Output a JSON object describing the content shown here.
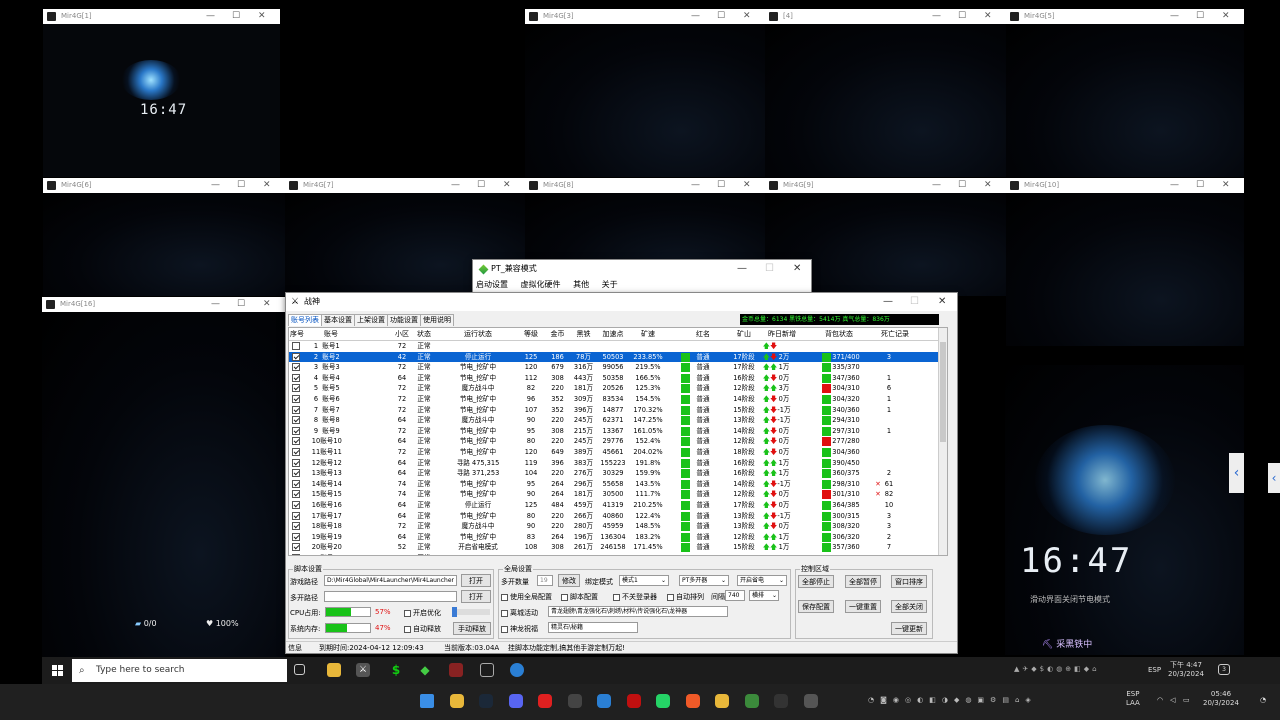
{
  "game_windows": [
    {
      "id": "w1",
      "title": "Mir4G[1]",
      "clock": "16:47"
    },
    {
      "id": "w3",
      "title": "Mir4G[3]"
    },
    {
      "id": "w4",
      "title": "[4]"
    },
    {
      "id": "w5",
      "title": "Mir4G[5]"
    },
    {
      "id": "w6",
      "title": "Mir4G[6]"
    },
    {
      "id": "w7",
      "title": "Mir4G[7]"
    },
    {
      "id": "w8",
      "title": "Mir4G[8]"
    },
    {
      "id": "w9",
      "title": "Mir4G[9]"
    },
    {
      "id": "w10",
      "title": "Mir4G[10]"
    },
    {
      "id": "w16",
      "title": "Mir4G[16]"
    }
  ],
  "game_hud": {
    "stat1": "0/0",
    "stat2": "100%"
  },
  "big_game": {
    "clock": "16:47",
    "hint": "滑动界面关闭节电模式",
    "status": "采黑铁中"
  },
  "pt_window": {
    "title": "PT_兼容模式",
    "menu": [
      "启动设置",
      "虚拟化硬件",
      "其他",
      "关于"
    ]
  },
  "main_window": {
    "title": "战神",
    "tabs": [
      "账号列表",
      "基本设置",
      "上架设置",
      "功能设置",
      "使用说明"
    ],
    "totals": "金币总量：6134  黑铁总量：5414万  真气总量：836万",
    "columns": [
      "序号",
      "账号",
      "小区",
      "状态",
      "运行状态",
      "等级",
      "金币",
      "黑铁",
      "加速点",
      "矿速",
      "红名",
      "矿山",
      "昨日新增",
      "背包状态",
      "死亡记录"
    ],
    "rows": [
      {
        "n": "1",
        "acct": "账号1",
        "zone": "72",
        "st": "正常",
        "run": "",
        "lv": "",
        "gold": "",
        "iron": "",
        "acc": "",
        "spd": "",
        "red": "",
        "mine": "",
        "y_dir": "up-down",
        "y": "",
        "bag": "",
        "bag_c": "",
        "death": "",
        "x": "",
        "chk": false
      },
      {
        "n": "2",
        "acct": "账号2",
        "zone": "42",
        "st": "正常",
        "run": "停止运行",
        "lv": "125",
        "gold": "186",
        "iron": "78万",
        "acc": "50503",
        "spd": "233.85%",
        "red": "普通",
        "mine": "17阶段",
        "y_dir": "up-down",
        "y": "2万",
        "bag": "371/400",
        "bag_c": "g",
        "death": "3",
        "x": "",
        "chk": true
      },
      {
        "n": "3",
        "acct": "账号3",
        "zone": "72",
        "st": "正常",
        "run": "节电_挖矿中",
        "lv": "120",
        "gold": "679",
        "iron": "316万",
        "acc": "99056",
        "spd": "219.5%",
        "red": "普通",
        "mine": "17阶段",
        "y_dir": "up-up",
        "y": "1万",
        "bag": "335/370",
        "bag_c": "g",
        "death": "",
        "x": "",
        "chk": true
      },
      {
        "n": "4",
        "acct": "账号4",
        "zone": "64",
        "st": "正常",
        "run": "节电_挖矿中",
        "lv": "112",
        "gold": "308",
        "iron": "443万",
        "acc": "50358",
        "spd": "166.5%",
        "red": "普通",
        "mine": "16阶段",
        "y_dir": "up-down",
        "y": "0万",
        "bag": "347/360",
        "bag_c": "g",
        "death": "1",
        "x": "",
        "chk": true
      },
      {
        "n": "5",
        "acct": "账号5",
        "zone": "72",
        "st": "正常",
        "run": "魔方战斗中",
        "lv": "82",
        "gold": "220",
        "iron": "181万",
        "acc": "20526",
        "spd": "125.3%",
        "red": "普通",
        "mine": "12阶段",
        "y_dir": "up-up",
        "y": "3万",
        "bag": "304/310",
        "bag_c": "r",
        "death": "6",
        "x": "",
        "chk": true
      },
      {
        "n": "6",
        "acct": "账号6",
        "zone": "72",
        "st": "正常",
        "run": "节电_挖矿中",
        "lv": "96",
        "gold": "352",
        "iron": "309万",
        "acc": "83534",
        "spd": "154.5%",
        "red": "普通",
        "mine": "14阶段",
        "y_dir": "up-down",
        "y": "0万",
        "bag": "304/320",
        "bag_c": "g",
        "death": "1",
        "x": "",
        "chk": true
      },
      {
        "n": "7",
        "acct": "账号7",
        "zone": "72",
        "st": "正常",
        "run": "节电_挖矿中",
        "lv": "107",
        "gold": "352",
        "iron": "396万",
        "acc": "14877",
        "spd": "170.32%",
        "red": "普通",
        "mine": "15阶段",
        "y_dir": "up-down",
        "y": "-1万",
        "bag": "340/360",
        "bag_c": "g",
        "death": "1",
        "x": "",
        "chk": true
      },
      {
        "n": "8",
        "acct": "账号8",
        "zone": "64",
        "st": "正常",
        "run": "魔方战斗中",
        "lv": "90",
        "gold": "220",
        "iron": "245万",
        "acc": "62371",
        "spd": "147.25%",
        "red": "普通",
        "mine": "13阶段",
        "y_dir": "up-down",
        "y": "-1万",
        "bag": "294/310",
        "bag_c": "g",
        "death": "",
        "x": "",
        "chk": true
      },
      {
        "n": "9",
        "acct": "账号9",
        "zone": "72",
        "st": "正常",
        "run": "节电_挖矿中",
        "lv": "95",
        "gold": "308",
        "iron": "215万",
        "acc": "13367",
        "spd": "161.05%",
        "red": "普通",
        "mine": "14阶段",
        "y_dir": "up-down",
        "y": "0万",
        "bag": "297/310",
        "bag_c": "g",
        "death": "1",
        "x": "",
        "chk": true
      },
      {
        "n": "10",
        "acct": "账号10",
        "zone": "64",
        "st": "正常",
        "run": "节电_挖矿中",
        "lv": "80",
        "gold": "220",
        "iron": "245万",
        "acc": "29776",
        "spd": "152.4%",
        "red": "普通",
        "mine": "12阶段",
        "y_dir": "up-down",
        "y": "0万",
        "bag": "277/280",
        "bag_c": "r",
        "death": "",
        "x": "",
        "chk": true
      },
      {
        "n": "11",
        "acct": "账号11",
        "zone": "72",
        "st": "正常",
        "run": "节电_挖矿中",
        "lv": "120",
        "gold": "649",
        "iron": "389万",
        "acc": "45661",
        "spd": "204.02%",
        "red": "普通",
        "mine": "18阶段",
        "y_dir": "up-down",
        "y": "0万",
        "bag": "304/360",
        "bag_c": "g",
        "death": "",
        "x": "",
        "chk": true
      },
      {
        "n": "12",
        "acct": "账号12",
        "zone": "64",
        "st": "正常",
        "run": "寻路 475,315",
        "lv": "119",
        "gold": "396",
        "iron": "383万",
        "acc": "155223",
        "spd": "191.8%",
        "red": "普通",
        "mine": "16阶段",
        "y_dir": "up-up",
        "y": "1万",
        "bag": "390/450",
        "bag_c": "g",
        "death": "",
        "x": "",
        "chk": true
      },
      {
        "n": "13",
        "acct": "账号13",
        "zone": "64",
        "st": "正常",
        "run": "寻路 371,253",
        "lv": "104",
        "gold": "220",
        "iron": "276万",
        "acc": "30329",
        "spd": "159.9%",
        "red": "普通",
        "mine": "16阶段",
        "y_dir": "up-up",
        "y": "1万",
        "bag": "360/375",
        "bag_c": "g",
        "death": "2",
        "x": "",
        "chk": true
      },
      {
        "n": "14",
        "acct": "账号14",
        "zone": "74",
        "st": "正常",
        "run": "节电_挖矿中",
        "lv": "95",
        "gold": "264",
        "iron": "296万",
        "acc": "55658",
        "spd": "143.5%",
        "red": "普通",
        "mine": "14阶段",
        "y_dir": "up-down",
        "y": "-1万",
        "bag": "298/310",
        "bag_c": "g",
        "death": "61",
        "x": "✕",
        "chk": true
      },
      {
        "n": "15",
        "acct": "账号15",
        "zone": "74",
        "st": "正常",
        "run": "节电_挖矿中",
        "lv": "90",
        "gold": "264",
        "iron": "181万",
        "acc": "30500",
        "spd": "111.7%",
        "red": "普通",
        "mine": "12阶段",
        "y_dir": "up-down",
        "y": "0万",
        "bag": "301/310",
        "bag_c": "r",
        "death": "82",
        "x": "✕",
        "chk": true
      },
      {
        "n": "16",
        "acct": "账号16",
        "zone": "64",
        "st": "正常",
        "run": "停止运行",
        "lv": "125",
        "gold": "484",
        "iron": "459万",
        "acc": "41319",
        "spd": "210.25%",
        "red": "普通",
        "mine": "17阶段",
        "y_dir": "up-down",
        "y": "0万",
        "bag": "364/385",
        "bag_c": "g",
        "death": "10",
        "x": "",
        "chk": true
      },
      {
        "n": "17",
        "acct": "账号17",
        "zone": "64",
        "st": "正常",
        "run": "节电_挖矿中",
        "lv": "80",
        "gold": "220",
        "iron": "266万",
        "acc": "40860",
        "spd": "122.4%",
        "red": "普通",
        "mine": "13阶段",
        "y_dir": "up-down",
        "y": "-1万",
        "bag": "300/315",
        "bag_c": "g",
        "death": "3",
        "x": "",
        "chk": true
      },
      {
        "n": "18",
        "acct": "账号18",
        "zone": "72",
        "st": "正常",
        "run": "魔方战斗中",
        "lv": "90",
        "gold": "220",
        "iron": "280万",
        "acc": "45959",
        "spd": "148.5%",
        "red": "普通",
        "mine": "13阶段",
        "y_dir": "up-down",
        "y": "0万",
        "bag": "308/320",
        "bag_c": "g",
        "death": "3",
        "x": "",
        "chk": true
      },
      {
        "n": "19",
        "acct": "账号19",
        "zone": "64",
        "st": "正常",
        "run": "节电_挖矿中",
        "lv": "83",
        "gold": "264",
        "iron": "196万",
        "acc": "136304",
        "spd": "183.2%",
        "red": "普通",
        "mine": "12阶段",
        "y_dir": "up-up",
        "y": "1万",
        "bag": "306/320",
        "bag_c": "g",
        "death": "2",
        "x": "",
        "chk": true
      },
      {
        "n": "20",
        "acct": "账号20",
        "zone": "52",
        "st": "正常",
        "run": "开启省电模式",
        "lv": "108",
        "gold": "308",
        "iron": "261万",
        "acc": "246158",
        "spd": "171.45%",
        "red": "普通",
        "mine": "15阶段",
        "y_dir": "up-up",
        "y": "1万",
        "bag": "357/360",
        "bag_c": "g",
        "death": "7",
        "x": "",
        "chk": true
      },
      {
        "n": "21",
        "acct": "账号21",
        "zone": "42",
        "st": "正常",
        "run": "",
        "lv": "",
        "gold": "",
        "iron": "",
        "acc": "",
        "spd": "",
        "red": "",
        "mine": "",
        "y_dir": "",
        "y": "",
        "bag": "",
        "bag_c": "",
        "death": "",
        "x": "",
        "chk": false
      }
    ],
    "script": {
      "legend": "脚本设置",
      "path_label": "游戏路径",
      "path_value": "D:\\Mir4Global\\Mir4Launcher\\Mir4Launcher",
      "open": "打开",
      "multi_label": "多开路径",
      "multi_value": "",
      "open2": "打开",
      "cpu_label": "CPU占用:",
      "cpu_pct": "57%",
      "cpu_fill": 0.57,
      "mem_label": "系统内存:",
      "mem_pct": "47%",
      "mem_fill": 0.47,
      "opt_label": "开启优化",
      "auto_release": "自动释放",
      "manual_release": "手动释放"
    },
    "global": {
      "legend": "全局设置",
      "count_label": "多开数量",
      "count_value": "19",
      "modify": "修改",
      "bind_label": "绑定模式",
      "bind_value": "模式1",
      "pt_value": "PT多开器",
      "sleep_value": "开启省电",
      "use_global": "使用全局配置",
      "script_config": "脚本配置",
      "close_login": "不关登录器",
      "auto_arrange": "自动排列",
      "interval_label": "间隔",
      "interval_value": "740",
      "layout_value": "横排",
      "mech_label": "离城活动",
      "mech_value": "青龙翅膀\\青龙强化石\\刺绣\\材料\\传说强化石\\龙神器",
      "dragon_label": "神龙祝福",
      "dragon_value": "精灵石\\秘籍"
    },
    "control": {
      "legend": "控制区域",
      "buttons": [
        "全部停止",
        "全部暂停",
        "窗口排序",
        "保存配置",
        "一键重置",
        "全部关闭",
        "一键更新"
      ]
    },
    "status": {
      "info": "信息",
      "expire": "到期时间:2024-04-12 12:09:43",
      "version": "当前版本:03.04A",
      "note": "挂脚本功能定制,搞其他手游定制万起!"
    }
  },
  "taskbar": {
    "search_placeholder": "Type here to search",
    "lang1": "ESP",
    "time1": "下午 4:47",
    "date1": "20/3/2024",
    "lang2": "ESP",
    "lang2b": "LAA",
    "time2": "05:46",
    "date2": "20/3/2024",
    "notif": "3"
  },
  "colors": {
    "accent": "#0a64d2",
    "green": "#19c219",
    "red": "#e01010",
    "totals_text": "#33ff33"
  }
}
